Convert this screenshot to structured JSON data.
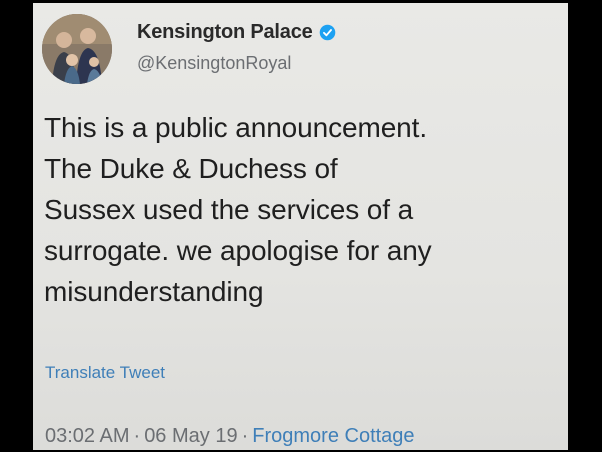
{
  "account": {
    "display_name": "Kensington Palace",
    "handle": "@KensingtonRoyal",
    "verified_icon": "verified-badge-icon"
  },
  "tweet": {
    "lines": [
      "This is a public announcement.",
      "The Duke & Duchess of",
      "Sussex used the services of a",
      "surrogate. we apologise for any",
      "misunderstanding"
    ],
    "translate_label": "Translate Tweet",
    "time": "03:02 AM",
    "date": "06 May 19",
    "location": "Frogmore Cottage",
    "separator": "·"
  },
  "colors": {
    "background": "#e6e6e3",
    "text": "#1f1f1f",
    "secondary_text": "#6b6e72",
    "link": "#3f7fb8",
    "verified": "#1da1f2"
  }
}
